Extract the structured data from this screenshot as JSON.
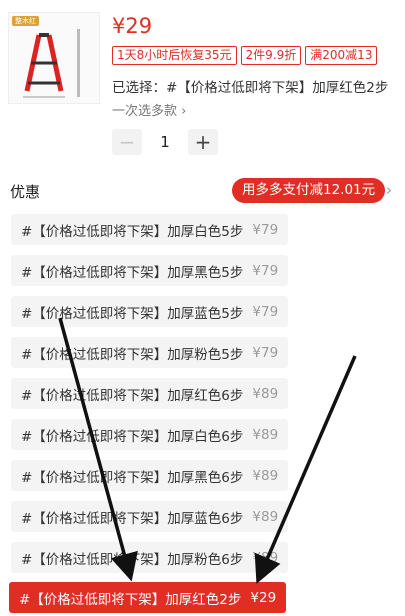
{
  "product": {
    "thumbnail_badge": "整木红",
    "thumbnail_icon": "ladder-image",
    "price": "¥29"
  },
  "promos": [
    "1天8小时后恢复35元",
    "2件9.9折",
    "满200减13"
  ],
  "selection": {
    "selected_text": "已选择：#【价格过低即将下架】加厚红色2步",
    "multi_select": "一次选多款 ›"
  },
  "quantity": {
    "minus": "−",
    "value": "1",
    "plus": "+"
  },
  "discount": {
    "label": "优惠",
    "pill": "用多多支付减12.01元",
    "chevron": "›"
  },
  "options": [
    {
      "name": "#【价格过低即将下架】加厚白色5步",
      "price": "¥79"
    },
    {
      "name": "#【价格过低即将下架】加厚黑色5步",
      "price": "¥79"
    },
    {
      "name": "#【价格过低即将下架】加厚蓝色5步",
      "price": "¥79"
    },
    {
      "name": "#【价格过低即将下架】加厚粉色5步",
      "price": "¥79"
    },
    {
      "name": "#【价格过低即将下架】加厚红色6步",
      "price": "¥89"
    },
    {
      "name": "#【价格过低即将下架】加厚白色6步",
      "price": "¥89"
    },
    {
      "name": "#【价格过低即将下架】加厚黑色6步",
      "price": "¥89"
    },
    {
      "name": "#【价格过低即将下架】加厚蓝色6步",
      "price": "¥89"
    },
    {
      "name": "#【价格过低即将下架】加厚粉色6步",
      "price": "¥89"
    },
    {
      "name": "#【价格过低即将下架】加厚红色2步",
      "price": "¥29"
    }
  ],
  "colors": {
    "accent": "#e02e24",
    "option_bg": "#f4f4f4",
    "annotation_arrow": "#111111"
  }
}
